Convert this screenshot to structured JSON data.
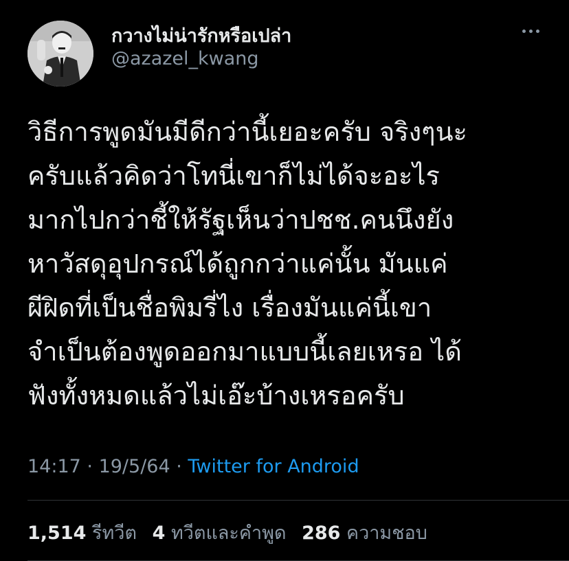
{
  "author": {
    "display_name": "กวางไม่น่ารักหรือเปล่า",
    "handle": "@azazel_kwang"
  },
  "tweet": {
    "lines": [
      "วิธีการพูดมันมีดีกว่านี้เยอะครับ จริงๆนะ",
      "ครับแล้วคิดว่าโทนี่เขาก็ไม่ได้จะอะไร",
      "มากไปกว่าชี้ให้รัฐเห็นว่าปชช.คนนึงยัง",
      "หาวัสดุอุปกรณ์ได้ถูกกว่าแค่นั้น มันแค่",
      "ผีฝิดที่เป็นชื่อพิมรี่ไง เรื่องมันแค่นี้เขา",
      "จำเป็นต้องพูดออกมาแบบนี้เลยเหรอ ได้",
      "ฟังทั้งหมดแล้วไม่เอ๊ะบ้างเหรอครับ"
    ]
  },
  "meta": {
    "time": "14:17",
    "separator": " · ",
    "date": "19/5/64",
    "source": "Twitter for Android"
  },
  "stats": {
    "retweets_count": "1,514",
    "retweets_label": "รีทวีต",
    "quotes_count": "4",
    "quotes_label": "ทวีตและคำพูด",
    "likes_count": "286",
    "likes_label": "ความชอบ"
  },
  "icons": {
    "more": "more-horizontal-icon"
  },
  "colors": {
    "background": "#000000",
    "primary_text": "#e7e9ea",
    "secondary_text": "#8b98a5",
    "link": "#1d9bf0"
  }
}
